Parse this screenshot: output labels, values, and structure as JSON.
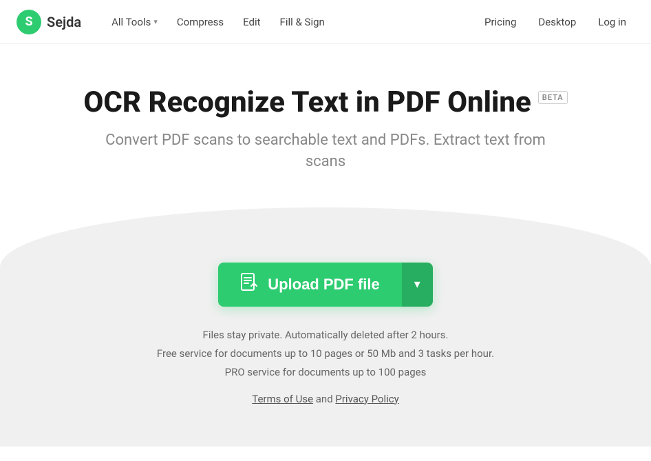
{
  "nav": {
    "logo_letter": "S",
    "logo_name": "Sejda",
    "links": [
      {
        "label": "All Tools",
        "has_dropdown": true
      },
      {
        "label": "Compress",
        "has_dropdown": false
      },
      {
        "label": "Edit",
        "has_dropdown": false
      },
      {
        "label": "Fill & Sign",
        "has_dropdown": false
      }
    ],
    "right_links": [
      {
        "label": "Pricing"
      },
      {
        "label": "Desktop"
      },
      {
        "label": "Log in"
      }
    ]
  },
  "hero": {
    "title": "OCR Recognize Text in PDF Online",
    "beta_label": "BETA",
    "subtitle": "Convert PDF scans to searchable text and PDFs. Extract text from scans"
  },
  "upload": {
    "button_label": "Upload PDF file",
    "dropdown_arrow": "▾"
  },
  "info": {
    "line1": "Files stay private. Automatically deleted after 2 hours.",
    "line2": "Free service for documents up to 10 pages or 50 Mb and 3 tasks per hour.",
    "line3": "PRO service for documents up to 100 pages"
  },
  "terms": {
    "prefix": "",
    "terms_label": "Terms of Use",
    "and_text": "and",
    "privacy_label": "Privacy Policy"
  }
}
